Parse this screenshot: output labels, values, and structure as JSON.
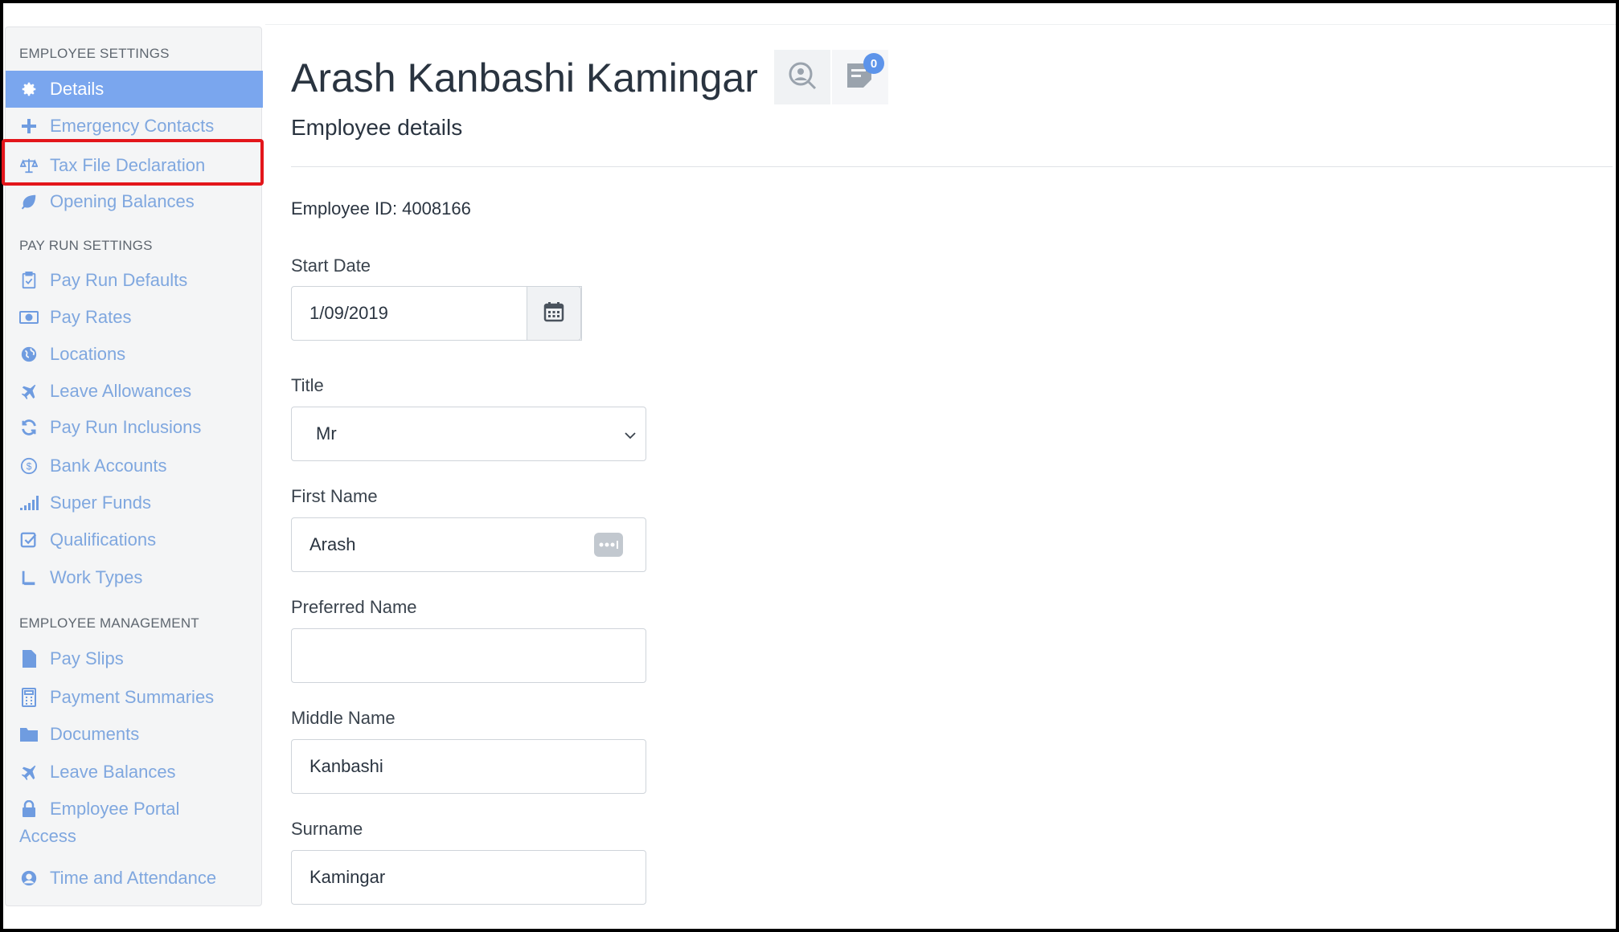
{
  "sidebar": {
    "sections": {
      "employee_settings": "EMPLOYEE SETTINGS",
      "pay_run_settings": "PAY RUN SETTINGS",
      "employee_management": "EMPLOYEE MANAGEMENT"
    },
    "items": {
      "details": "Details",
      "emergency_contacts": "Emergency Contacts",
      "tax_file_declaration": "Tax File Declaration",
      "opening_balances": "Opening Balances",
      "pay_run_defaults": "Pay Run Defaults",
      "pay_rates": "Pay Rates",
      "locations": "Locations",
      "leave_allowances": "Leave Allowances",
      "pay_run_inclusions": "Pay Run Inclusions",
      "bank_accounts": "Bank Accounts",
      "super_funds": "Super Funds",
      "qualifications": "Qualifications",
      "work_types": "Work Types",
      "pay_slips": "Pay Slips",
      "payment_summaries": "Payment Summaries",
      "documents": "Documents",
      "leave_balances": "Leave Balances",
      "employee_portal_access_line1": "Employee Portal",
      "employee_portal_access_line2": "Access",
      "time_and_attendance": "Time and Attendance"
    },
    "active_item": "details",
    "highlighted_item": "tax_file_declaration"
  },
  "header": {
    "title": "Arash Kanbashi Kamingar",
    "notes_count": "0",
    "subtitle": "Employee details"
  },
  "employee": {
    "id_text": "Employee ID: 4008166"
  },
  "form": {
    "start_date_label": "Start Date",
    "start_date_value": "1/09/2019",
    "title_label": "Title",
    "title_value": "Mr",
    "first_name_label": "First Name",
    "first_name_value": "Arash",
    "preferred_name_label": "Preferred Name",
    "preferred_name_value": "",
    "middle_name_label": "Middle Name",
    "middle_name_value": "Kanbashi",
    "surname_label": "Surname",
    "surname_value": "Kamingar"
  },
  "colors": {
    "accent": "#7aa6ee",
    "link": "#7fa7df",
    "highlight": "#e3161b",
    "badge": "#5d94ea"
  }
}
